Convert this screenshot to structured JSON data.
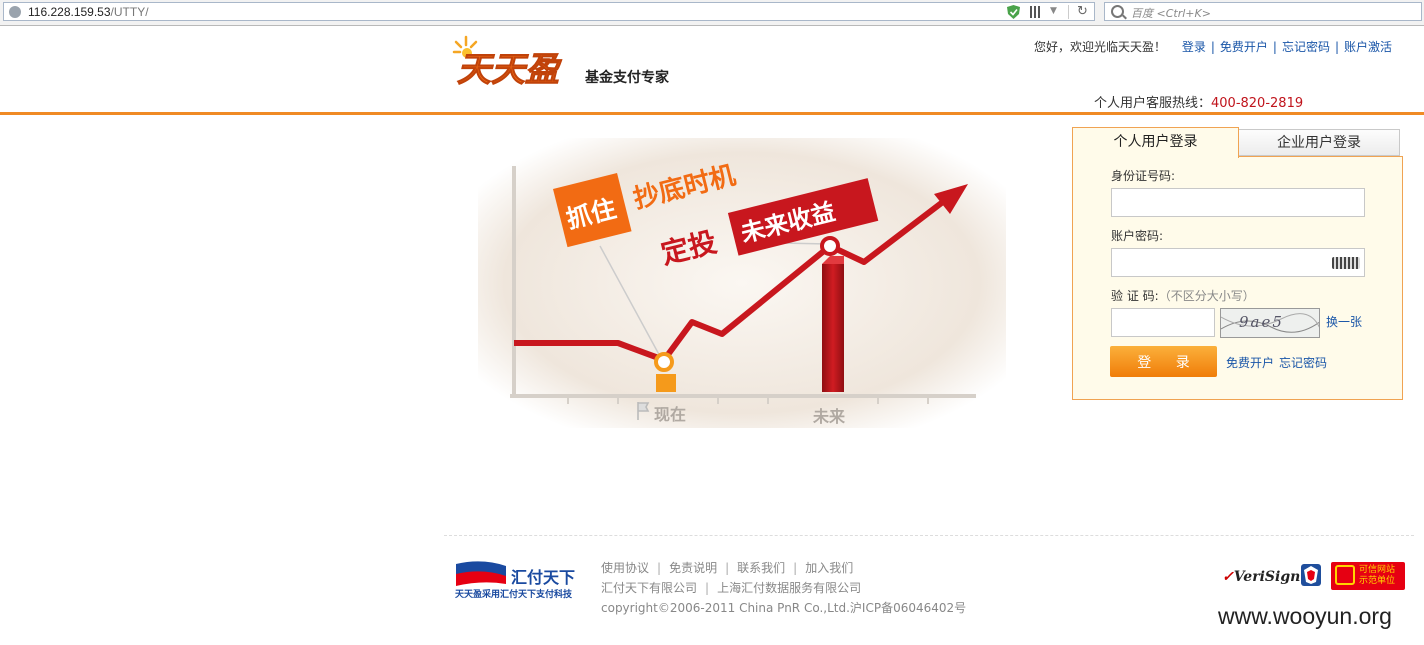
{
  "browser": {
    "url_host": "116.228.159.53",
    "url_path": "/UTTY/",
    "search_placeholder": "百度 <Ctrl+K>"
  },
  "header": {
    "logo_text": "天天盈",
    "tagline": "基金支付专家",
    "greeting": "您好，欢迎光临天天盈！",
    "nav": [
      "登录",
      "免费开户",
      "忘记密码",
      "账户激活"
    ],
    "hotline_label": "个人用户客服热线：",
    "hotline_number": "400-820-2819"
  },
  "banner": {
    "tag_grab": "抓住",
    "text_bottom_time": "抄底时机",
    "text_invest": "定投",
    "tag_future_gain": "未来收益",
    "label_now": "现在",
    "label_future": "未来"
  },
  "login": {
    "tabs": [
      "个人用户登录",
      "企业用户登录"
    ],
    "active_tab": 0,
    "id_label": "身份证号码:",
    "id_value": "",
    "password_label": "账户密码:",
    "password_value": "",
    "captcha_label": "验 证 码:",
    "captcha_hint": "（不区分大小写）",
    "captcha_value": "",
    "captcha_image_text": "9ae5",
    "refresh_link": "换一张",
    "submit": "登 录",
    "links": [
      "免费开户",
      "忘记密码"
    ]
  },
  "footer": {
    "partner_name": "汇付天下",
    "partner_slogan": "天天盈采用汇付天下支付科技",
    "links": [
      "使用协议",
      "免责说明",
      "联系我们",
      "加入我们"
    ],
    "companies": [
      "汇付天下有限公司",
      "上海汇付数据服务有限公司"
    ],
    "copyright": "copyright©2006-2011 China PnR Co.,Ltd.沪ICP备06046402号",
    "verisign": "VeriSign",
    "badge_text": "可信网站 示范单位"
  },
  "watermark": "www.wooyun.org",
  "colors": {
    "accent_orange": "#f08a24",
    "link_blue": "#1a56a8",
    "hotline_red": "#c0141c",
    "banner_red": "#c8171e",
    "banner_orange": "#f26b13"
  }
}
